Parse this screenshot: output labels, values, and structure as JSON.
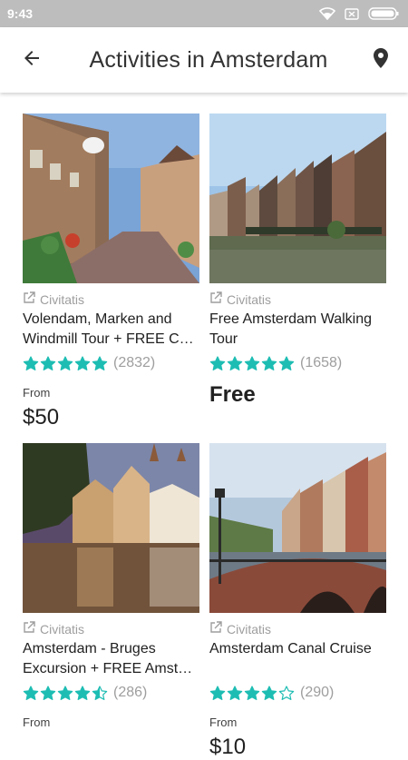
{
  "status_bar": {
    "time": "9:43"
  },
  "app_bar": {
    "title": "Activities in Amsterdam"
  },
  "colors": {
    "star": "#1ebdb3",
    "accent_gray": "#9e9e9e"
  },
  "activities": [
    {
      "provider": "Civitatis",
      "title": "Volendam, Marken and Windmill Tour + FREE C…",
      "rating": 5,
      "reviews": "(2832)",
      "from_label": "From",
      "price": "$50"
    },
    {
      "provider": "Civitatis",
      "title": "Free Amsterdam Walking Tour",
      "rating": 5,
      "reviews": "(1658)",
      "from_label": "",
      "price": "Free"
    },
    {
      "provider": "Civitatis",
      "title": "Amsterdam - Bruges Excursion  + FREE Amst…",
      "rating": 4.5,
      "reviews": "(286)",
      "from_label": "From",
      "price": ""
    },
    {
      "provider": "Civitatis",
      "title": "Amsterdam Canal Cruise",
      "rating": 4,
      "reviews": "(290)",
      "from_label": "From",
      "price": "$10"
    }
  ]
}
